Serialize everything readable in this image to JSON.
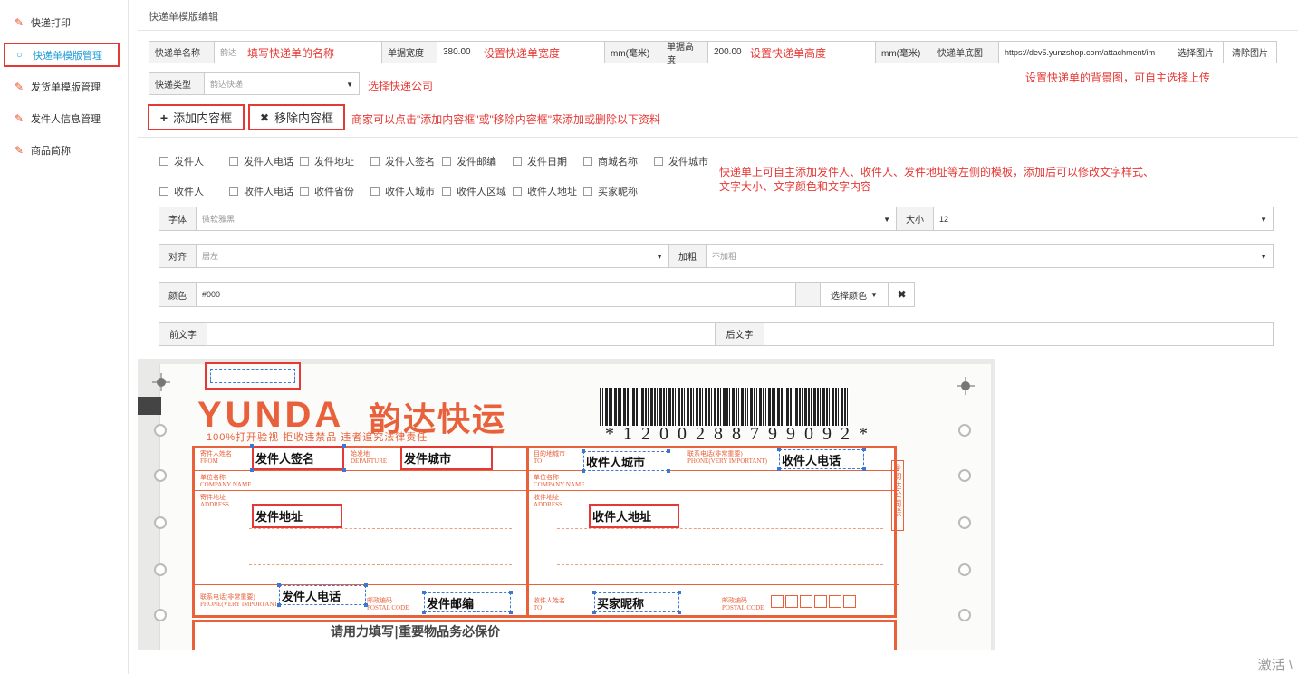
{
  "sidebar": {
    "items": [
      {
        "label": "快递打印",
        "icon": "magic-wand-icon"
      },
      {
        "label": "快递单模版管理",
        "icon": "circle-icon"
      },
      {
        "label": "发货单模版管理",
        "icon": "edit-icon"
      },
      {
        "label": "发件人信息管理",
        "icon": "edit-icon"
      },
      {
        "label": "商品简称",
        "icon": "edit-icon"
      }
    ]
  },
  "page": {
    "title": "快递单模版编辑"
  },
  "row1": {
    "name_label": "快递单名称",
    "name_value": "韵达",
    "name_annot": "填写快递单的名称",
    "width_label": "单据宽度",
    "width_value": "380.00",
    "width_annot": "设置快递单宽度",
    "unit1": "mm(毫米)",
    "height_label": "单据高度",
    "height_value": "200.00",
    "height_annot": "设置快递单高度",
    "unit2": "mm(毫米)",
    "bg_label": "快递单底图",
    "bg_value": "https://dev5.yunzshop.com/attachment/im",
    "choose_img": "选择图片",
    "clear_img": "清除图片",
    "bg_annot": "设置快递单的背景图，可自主选择上传"
  },
  "row2": {
    "type_label": "快递类型",
    "type_value": "韵达快递",
    "type_annot": "选择快递公司"
  },
  "row3": {
    "add_label": "添加内容框",
    "remove_label": "移除内容框",
    "annot": "商家可以点击\"添加内容框\"或\"移除内容框\"来添加或删除以下资料"
  },
  "checkboxes": {
    "row1": [
      "发件人",
      "发件人电话",
      "发件地址",
      "发件人签名",
      "发件邮编",
      "发件日期",
      "商城名称",
      "发件城市"
    ],
    "row2": [
      "收件人",
      "收件人电话",
      "收件省份",
      "收件人城市",
      "收件人区域",
      "收件人地址",
      "买家昵称"
    ],
    "annot_line1": "快递单上可自主添加发件人、收件人、发件地址等左侧的模板，添加后可以修改文字样式、",
    "annot_line2": "文字大小、文字颜色和文字内容"
  },
  "style_form": {
    "font_label": "字体",
    "font_value": "微软雅黑",
    "size_label": "大小",
    "size_value": "12",
    "align_label": "对齐",
    "align_value": "居左",
    "bold_label": "加粗",
    "bold_value": "不加粗",
    "color_label": "颜色",
    "color_value": "#000",
    "choose_color": "选择颜色",
    "prefix_label": "前文字",
    "suffix_label": "后文字"
  },
  "waybill": {
    "logo": "YUNDA",
    "logo_cn": "韵达快运",
    "slogan": "100%打开验视  拒收违禁品  违者追究法律责任",
    "barcode_number": "*1200288799092*",
    "side_tag": "①韵达公司联",
    "bottom_title": "请用力填写|重要物品务必保价",
    "labels": {
      "from": "寄件人姓名\nFROM",
      "departure": "始发地\nDEPARTURE",
      "to": "目的地城市\nTO",
      "phone_to": "联系电话(非常重要)\nPHONE(VERY IMPORTANT)",
      "company": "单位名称\nCOMPANY NAME",
      "address": "寄件地址\nADDRESS",
      "address_to": "收件地址\nADDRESS",
      "phone_from": "联系电话(非常重要)\nPHONE(VERY IMPORTANT)",
      "postal": "邮政编码\nPOSTAL CODE",
      "receiver": "收件人姓名\nTO",
      "postal_to": "邮政编码\nPOSTAL CODE"
    },
    "fields": {
      "sender_sign": "发件人签名",
      "sender_city": "发件城市",
      "receiver_city": "收件人城市",
      "receiver_phone": "收件人电话",
      "sender_address": "发件地址",
      "receiver_address": "收件人地址",
      "sender_phone": "发件人电话",
      "sender_postcode": "发件邮编",
      "buyer_nick": "买家昵称"
    }
  },
  "watermark": "激活 \\"
}
